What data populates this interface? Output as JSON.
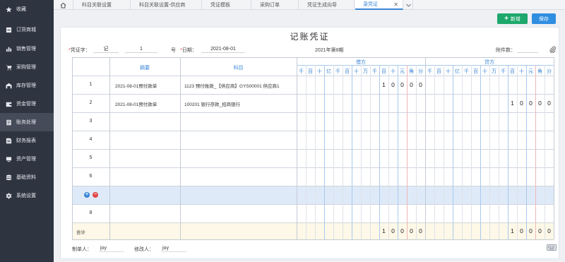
{
  "sidebar": {
    "items": [
      {
        "label": "收藏",
        "icon": "star-icon"
      },
      {
        "label": "订货商城",
        "icon": "store-icon"
      },
      {
        "label": "销售管理",
        "icon": "bar-chart-icon"
      },
      {
        "label": "采购管理",
        "icon": "cart-icon"
      },
      {
        "label": "库存管理",
        "icon": "warehouse-icon"
      },
      {
        "label": "资金管理",
        "icon": "wallet-icon"
      },
      {
        "label": "账务处理",
        "icon": "ledger-icon"
      },
      {
        "label": "财务报表",
        "icon": "report-icon"
      },
      {
        "label": "资产管理",
        "icon": "asset-icon"
      },
      {
        "label": "基础资料",
        "icon": "database-icon"
      },
      {
        "label": "系统设置",
        "icon": "gear-icon"
      }
    ],
    "active_index": 6
  },
  "tabs": [
    {
      "label": "科目关联设置"
    },
    {
      "label": "科目关联设置-供应商"
    },
    {
      "label": "凭证模板"
    },
    {
      "label": "采购订单"
    },
    {
      "label": "凭证生成向导"
    },
    {
      "label": "录凭证",
      "close": "✕"
    }
  ],
  "toolbar": {
    "new_label": "新增",
    "save_label": "保存",
    "plus": "+"
  },
  "voucher": {
    "title": "记账凭证",
    "word_label": "凭证字：",
    "word_value": "记",
    "number_value": "1",
    "number_suffix": "号",
    "date_label": "日期：",
    "date_value": "2021-08-01",
    "period": "2021年第8期",
    "attachment_label": "附件数："
  },
  "grid": {
    "summary_header": "摘要",
    "account_header": "科目",
    "debit_header": "借方",
    "credit_header": "贷方",
    "digit_headers": [
      "千",
      "百",
      "十",
      "亿",
      "千",
      "百",
      "十",
      "万",
      "千",
      "百",
      "十",
      "元",
      "角",
      "分"
    ],
    "rows": [
      {
        "num": "1",
        "summary": "2021-08-01预付款单",
        "account": "1123 预付账款_【供应商】GYS00001 供应商1",
        "debit": [
          "1",
          "0",
          "0",
          "0",
          "0"
        ],
        "credit": [
          "",
          "",
          "",
          "",
          ""
        ]
      },
      {
        "num": "2",
        "summary": "2021-08-01预付款单",
        "account": "100201 银行存款_招商银行",
        "debit": [
          "",
          "",
          "",
          "",
          ""
        ],
        "credit": [
          "1",
          "0",
          "0",
          "0",
          "0"
        ]
      },
      {
        "num": "3",
        "summary": "",
        "account": "",
        "debit": [
          "",
          "",
          "",
          "",
          ""
        ],
        "credit": [
          "",
          "",
          "",
          "",
          ""
        ]
      },
      {
        "num": "4",
        "summary": "",
        "account": "",
        "debit": [
          "",
          "",
          "",
          "",
          ""
        ],
        "credit": [
          "",
          "",
          "",
          "",
          ""
        ]
      },
      {
        "num": "5",
        "summary": "",
        "account": "",
        "debit": [
          "",
          "",
          "",
          "",
          ""
        ],
        "credit": [
          "",
          "",
          "",
          "",
          ""
        ]
      },
      {
        "num": "6",
        "summary": "",
        "account": "",
        "debit": [
          "",
          "",
          "",
          "",
          ""
        ],
        "credit": [
          "",
          "",
          "",
          "",
          ""
        ]
      },
      {
        "num": "",
        "summary": "",
        "account": "",
        "debit": [
          "",
          "",
          "",
          "",
          ""
        ],
        "credit": [
          "",
          "",
          "",
          "",
          ""
        ]
      },
      {
        "num": "8",
        "summary": "",
        "account": "",
        "debit": [
          "",
          "",
          "",
          "",
          ""
        ],
        "credit": [
          "",
          "",
          "",
          "",
          ""
        ]
      }
    ],
    "selected_row_index": 6,
    "add_symbol": "+",
    "remove_symbol": "−",
    "total_label": "合计",
    "total_debit": [
      "1",
      "0",
      "0",
      "0",
      "0"
    ],
    "total_credit": [
      "1",
      "0",
      "0",
      "0",
      "0"
    ]
  },
  "footer": {
    "maker_label": "制单人：",
    "maker_value": "joy",
    "editor_label": "修改人：",
    "editor_value": "joy"
  },
  "colors": {
    "sidebar_bg": "#2f3441",
    "sidebar_active": "#454b59",
    "accent_blue": "#3a86d6",
    "new_button": "#1ea86c",
    "save_button": "#2f8ee0",
    "selected_row": "#dfeaf8",
    "total_row": "#fdf8e7"
  }
}
